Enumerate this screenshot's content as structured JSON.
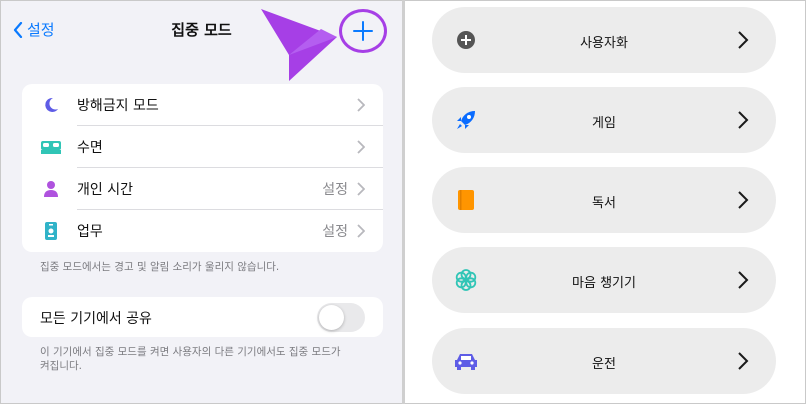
{
  "left": {
    "back_label": "설정",
    "title": "집중 모드",
    "modes": [
      {
        "label": "방해금지 모드",
        "value": "",
        "icon": "moon-icon",
        "color": "#5e5ce6"
      },
      {
        "label": "수면",
        "value": "",
        "icon": "bed-icon",
        "color": "#30c5b6"
      },
      {
        "label": "개인 시간",
        "value": "설정",
        "icon": "person-icon",
        "color": "#af52de"
      },
      {
        "label": "업무",
        "value": "설정",
        "icon": "id-badge-icon",
        "color": "#30b3c8"
      }
    ],
    "modes_note": "집중 모드에서는 경고 및 알림 소리가 울리지 않습니다.",
    "share_label": "모든 기기에서 공유",
    "share_on": false,
    "share_note": "이 기기에서 집중 모드를 켜면 사용자의 다른 기기에서도 집중 모드가 켜집니다."
  },
  "right": {
    "options": [
      {
        "label": "사용자화",
        "icon": "plus-circle-icon",
        "color": "#555555"
      },
      {
        "label": "게임",
        "icon": "rocket-icon",
        "color": "#0a6cff"
      },
      {
        "label": "독서",
        "icon": "book-icon",
        "color": "#ff9500"
      },
      {
        "label": "마음 챙기기",
        "icon": "flower-icon",
        "color": "#30c5b6"
      },
      {
        "label": "운전",
        "icon": "car-icon",
        "color": "#5e5ce6"
      }
    ]
  },
  "colors": {
    "accent": "#0a7aff",
    "highlight": "#a63fe6"
  }
}
